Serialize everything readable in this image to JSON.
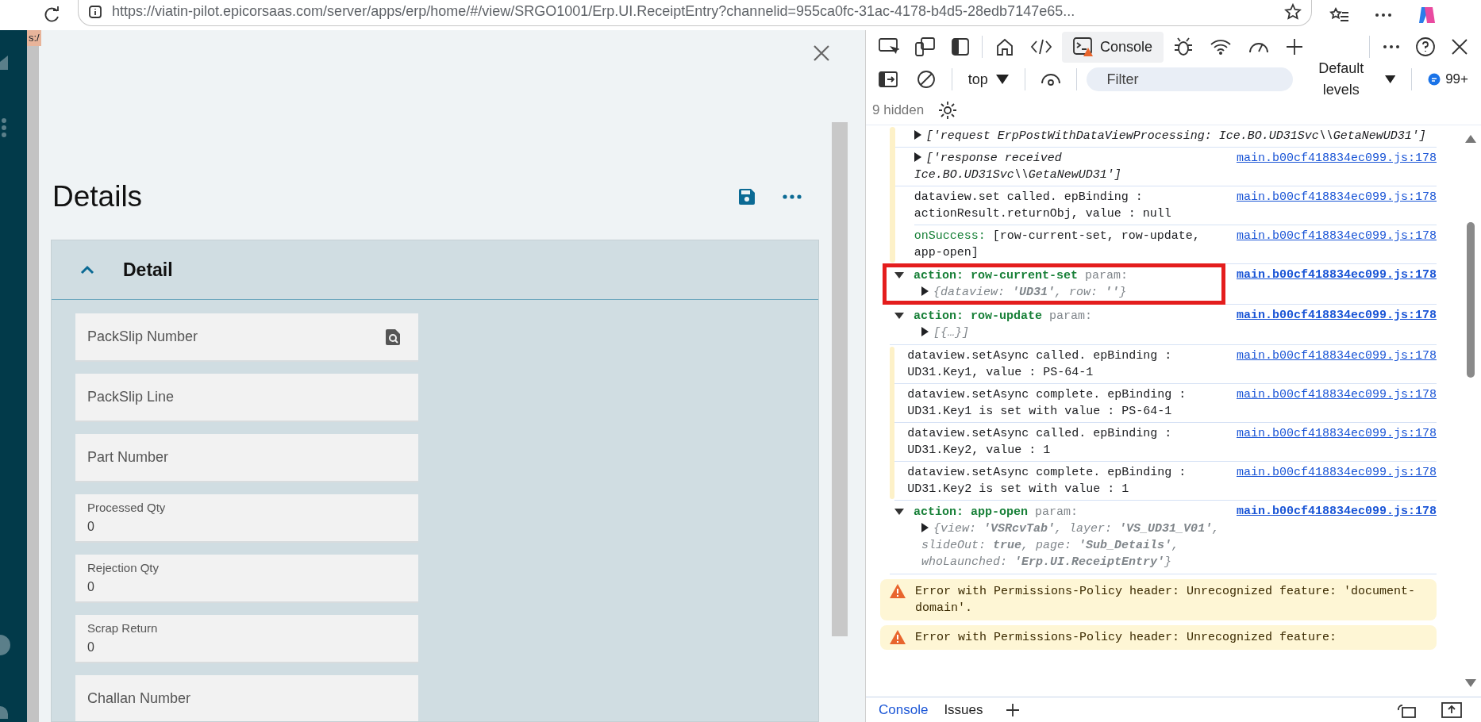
{
  "browser": {
    "url": "https://viatin-pilot.epicorsaas.com/server/apps/erp/home/#/view/SRGO1001/Erp.UI.ReceiptEntry?channelid=955ca0fc-31ac-4178-b4d5-28edb7147e65...",
    "tooltip_fragment": "s:/"
  },
  "panel": {
    "title": "Details",
    "section": {
      "title": "Detail",
      "expanded": true,
      "fields": [
        {
          "label": "PackSlip Number",
          "lookup": true
        },
        {
          "label": "PackSlip Line",
          "lookup": false
        },
        {
          "label": "Part Number",
          "lookup": false
        },
        {
          "label": "Processed Qty",
          "value": "0",
          "lookup": false
        },
        {
          "label": "Rejection Qty",
          "value": "0",
          "lookup": false
        },
        {
          "label": "Scrap Return",
          "value": "0",
          "lookup": false
        },
        {
          "label": "Challan Number",
          "lookup": false
        }
      ]
    }
  },
  "devtools": {
    "tabs": [
      {
        "label": "Console",
        "selected": true,
        "warning": true
      }
    ],
    "context": "top",
    "filter": {
      "placeholder": "Filter"
    },
    "levels": "Default levels",
    "message_count": "99+",
    "hidden": "9 hidden",
    "entries": [
      {
        "kind": "group",
        "children": [
          {
            "kind": "log",
            "expandable": true,
            "italic": true,
            "text": "['request ErpPostWithDataViewProcessing: Ice.BO.UD31Svc\\\\GetaNewUD31']"
          },
          {
            "kind": "log",
            "expandable": true,
            "italic": true,
            "source": "main.b00cf418834ec099.js:178",
            "text": "['response received Ice.BO.UD31Svc\\\\GetaNewUD31']"
          },
          {
            "kind": "log",
            "source": "main.b00cf418834ec099.js:178",
            "text": "dataview.set called. epBinding : actionResult.returnObj, value : null"
          },
          {
            "kind": "log",
            "source": "main.b00cf418834ec099.js:178",
            "prefix": "onSuccess:",
            "text": " [row-current-set, row-update, app-open]"
          }
        ]
      },
      {
        "kind": "group",
        "expanded": true,
        "highlighted": true,
        "label": "action: row-current-set",
        "suffix": "param:",
        "source": "main.b00cf418834ec099.js:178",
        "detail": "{*dataview*: **'UD31'**, *row*: **''**}"
      },
      {
        "kind": "group",
        "expanded": true,
        "highlighted": false,
        "label": "action: row-update",
        "suffix": "param:",
        "source": "main.b00cf418834ec099.js:178",
        "detail": "[{…}]",
        "children": [
          {
            "kind": "log",
            "source": "main.b00cf418834ec099.js:178",
            "text": "dataview.setAsync called. epBinding : UD31.Key1, value : PS-64-1"
          },
          {
            "kind": "log",
            "source": "main.b00cf418834ec099.js:178",
            "text": "dataview.setAsync complete. epBinding : UD31.Key1 is set with value : PS-64-1"
          },
          {
            "kind": "log",
            "source": "main.b00cf418834ec099.js:178",
            "text": "dataview.setAsync called. epBinding : UD31.Key2, value : 1"
          },
          {
            "kind": "log",
            "source": "main.b00cf418834ec099.js:178",
            "text": "dataview.setAsync complete. epBinding : UD31.Key2 is set with value : 1"
          }
        ]
      },
      {
        "kind": "group",
        "expanded": true,
        "highlighted": false,
        "label": "action: app-open",
        "suffix": "param:",
        "source": "main.b00cf418834ec099.js:178",
        "detail": "{*view*: **'VSRcvTab'**, *layer*: **'VS_UD31_V01'**, *slideOut*: **true**, *page*: **'Sub_Details'**, *whoLaunched*: **'Erp.UI.ReceiptEntry'**}"
      },
      {
        "kind": "warning",
        "text": "Error with Permissions-Policy header: Unrecognized feature: 'document-domain'."
      },
      {
        "kind": "warning",
        "text": "Error with Permissions-Policy header: Unrecognized feature:"
      }
    ],
    "drawer_tabs": [
      {
        "label": "Console",
        "selected": true
      },
      {
        "label": "Issues",
        "selected": false
      }
    ]
  }
}
